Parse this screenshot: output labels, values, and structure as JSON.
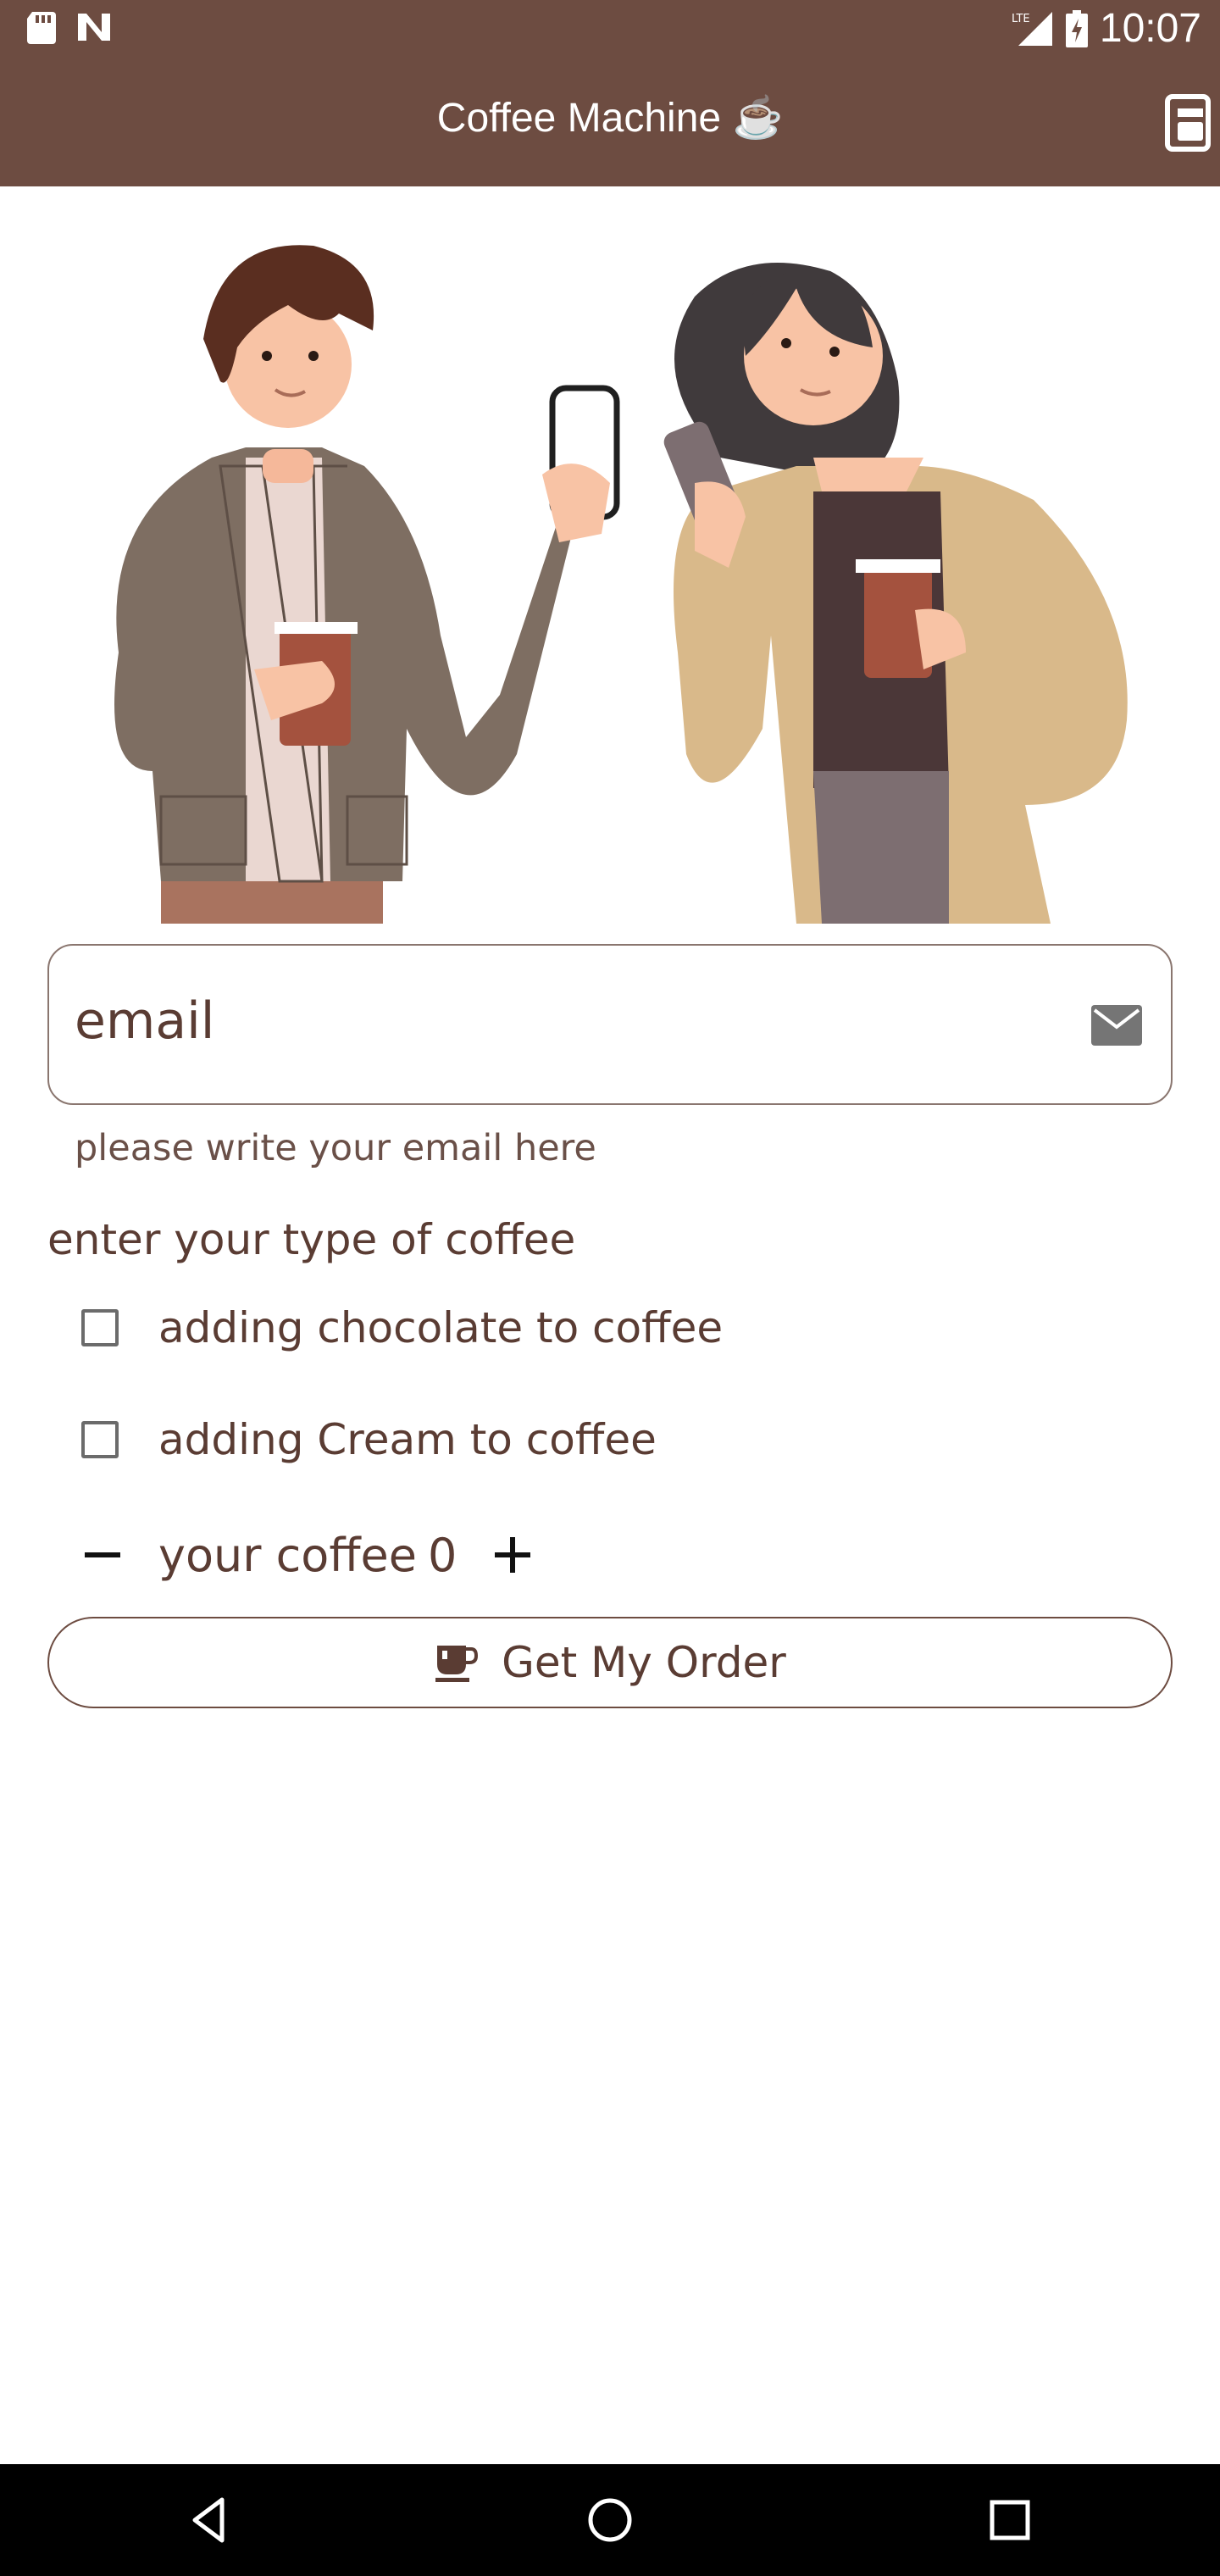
{
  "status_bar": {
    "time": "10:07",
    "network": "LTE",
    "icons": [
      "sd-card-icon",
      "n-app-icon",
      "signal-icon",
      "battery-charging-icon"
    ]
  },
  "app_bar": {
    "title": "Coffee Machine ☕",
    "action_icon": "coffee-machine-icon"
  },
  "illustration": {
    "icon": "people-with-coffee-illustration"
  },
  "email": {
    "value": "email",
    "helper": "please write your email here",
    "icon": "mail-icon"
  },
  "options": {
    "title": "enter your type of coffee",
    "items": [
      {
        "label": "adding chocolate to coffee",
        "checked": false
      },
      {
        "label": "adding Cream to coffee",
        "checked": false
      }
    ]
  },
  "quantity": {
    "label": "your coffee",
    "value": "0",
    "decrement_icon": "minus-icon",
    "increment_icon": "plus-icon"
  },
  "order": {
    "label": "Get My Order",
    "icon": "coffee-cup-icon"
  },
  "nav": {
    "icons": [
      "back-icon",
      "home-icon",
      "recents-icon"
    ]
  },
  "colors": {
    "primary": "#6d4c41",
    "text": "#5a3c33",
    "background": "#ffffff"
  }
}
